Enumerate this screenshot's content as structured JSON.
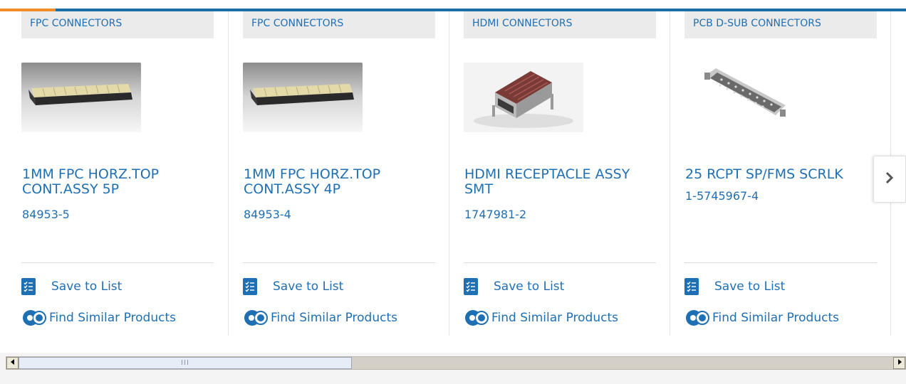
{
  "cards": [
    {
      "category": "FPC CONNECTORS",
      "title_line1": "1MM FPC HORZ.TOP",
      "title_line2": "CONT.ASSY 5P",
      "part_number": "84953-5",
      "image": "fpc-connector-photo",
      "save_label": "Save to List",
      "similar_label": "Find Similar Products"
    },
    {
      "category": "FPC CONNECTORS",
      "title_line1": "1MM FPC HORZ.TOP",
      "title_line2": "CONT.ASSY 4P",
      "part_number": "84953-4",
      "image": "fpc-connector-photo",
      "save_label": "Save to List",
      "similar_label": "Find Similar Products"
    },
    {
      "category": "HDMI CONNECTORS",
      "title_line1": "HDMI RECEPTACLE ASSY",
      "title_line2": "SMT",
      "part_number": "1747981-2",
      "image": "hdmi-receptacle-photo",
      "save_label": "Save to List",
      "similar_label": "Find Similar Products"
    },
    {
      "category": "PCB D-SUB CONNECTORS",
      "title_line1": "25 RCPT SP/FMS SCRLK",
      "title_line2": "",
      "part_number": "1-5745967-4",
      "image": "dsub-connector-photo",
      "save_label": "Save to List",
      "similar_label": "Find Similar Products"
    }
  ],
  "carousel": {
    "next_icon": "chevron-right-icon"
  },
  "scrollbar": {
    "left_icon": "arrow-left-icon",
    "right_icon": "arrow-right-icon",
    "grip": "III"
  },
  "colors": {
    "link": "#1f6fb5",
    "accent_bar": "#1b6fa8",
    "accent_orange": "#f28c28",
    "category_bg": "#ebebeb"
  }
}
